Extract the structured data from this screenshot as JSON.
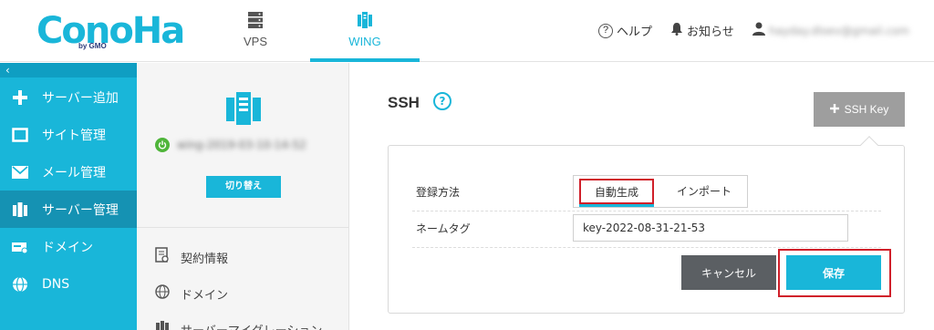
{
  "brand": {
    "logo": "ConoHa",
    "logo_sub": "by GMO"
  },
  "topnav": {
    "vps_label": "VPS",
    "wing_label": "WING"
  },
  "header_links": {
    "help": "ヘルプ",
    "news": "お知らせ",
    "user_email": "hayday.dloev@gmail.com"
  },
  "sidebar": {
    "collapse": "‹",
    "items": [
      {
        "label": "サーバー追加",
        "icon": "plus-icon"
      },
      {
        "label": "サイト管理",
        "icon": "window-icon"
      },
      {
        "label": "メール管理",
        "icon": "mail-icon"
      },
      {
        "label": "サーバー管理",
        "icon": "server-icon"
      },
      {
        "label": "ドメイン",
        "icon": "domain-icon"
      },
      {
        "label": "DNS",
        "icon": "globe-icon"
      }
    ]
  },
  "panel": {
    "server_name": "wing-2019-03-10-14-52",
    "switch_label": "切り替え",
    "links": [
      {
        "label": "契約情報",
        "icon": "contract-icon"
      },
      {
        "label": "ドメイン",
        "icon": "globe-icon"
      },
      {
        "label": "サーバーマイグレーション",
        "icon": "migration-icon"
      }
    ]
  },
  "main": {
    "title": "SSH",
    "help_glyph": "?",
    "sshkey_label": "SSH Key",
    "form": {
      "method_label": "登録方法",
      "method_options": [
        "自動生成",
        "インポート"
      ],
      "selected_method": "自動生成",
      "nametag_label": "ネームタグ",
      "nametag_value": "key-2022-08-31-21-53",
      "cancel_label": "キャンセル",
      "save_label": "保存"
    }
  },
  "colors": {
    "accent": "#19b6d9",
    "sidebar_active": "#1592b3",
    "highlight": "#d0202a",
    "power": "#4fb53a"
  }
}
